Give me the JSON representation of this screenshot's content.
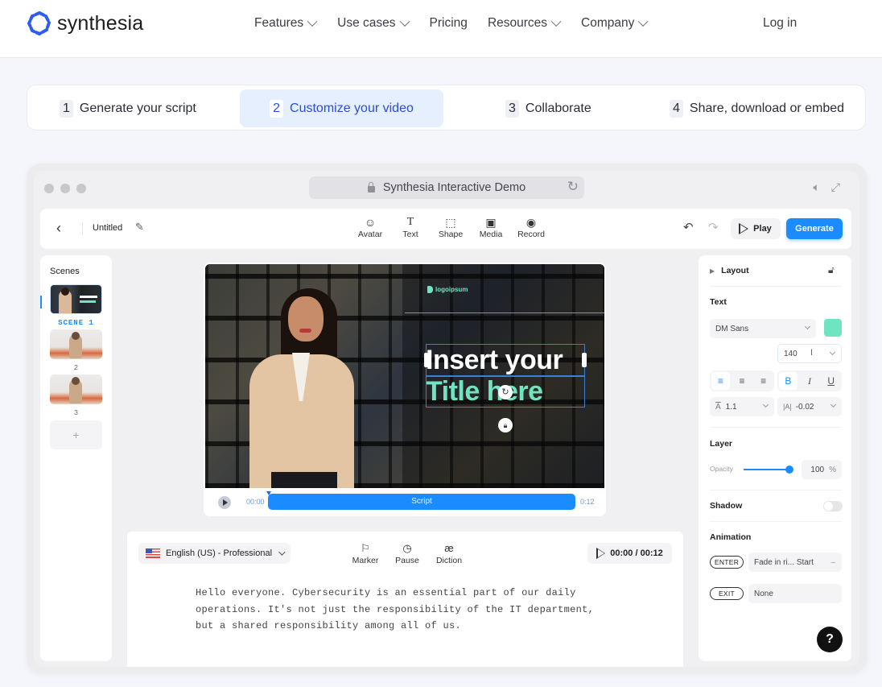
{
  "brand": {
    "name": "synthesia",
    "accent": "#2a4fd8"
  },
  "nav": {
    "items": [
      {
        "label": "Features",
        "dropdown": true
      },
      {
        "label": "Use cases",
        "dropdown": true
      },
      {
        "label": "Pricing",
        "dropdown": false
      },
      {
        "label": "Resources",
        "dropdown": true
      },
      {
        "label": "Company",
        "dropdown": true
      }
    ],
    "login": "Log in"
  },
  "steps": [
    {
      "num": "1",
      "label": "Generate your script",
      "active": false
    },
    {
      "num": "2",
      "label": "Customize your video",
      "active": true
    },
    {
      "num": "3",
      "label": "Collaborate",
      "active": false
    },
    {
      "num": "4",
      "label": "Share, download or embed",
      "active": false
    }
  ],
  "browser": {
    "url_title": "Synthesia Interactive Demo"
  },
  "editor": {
    "title": "Untitled",
    "tools": [
      {
        "icon": "avatar-icon",
        "label": "Avatar"
      },
      {
        "icon": "text-icon",
        "label": "Text"
      },
      {
        "icon": "shape-icon",
        "label": "Shape"
      },
      {
        "icon": "media-icon",
        "label": "Media"
      },
      {
        "icon": "record-icon",
        "label": "Record"
      }
    ],
    "play_label": "Play",
    "generate_label": "Generate",
    "generate_color": "#1a8cff"
  },
  "scenes": {
    "title": "Scenes",
    "items": [
      {
        "label": "SCENE 1",
        "active": true
      },
      {
        "label": "2",
        "active": false
      },
      {
        "label": "3",
        "active": false
      }
    ],
    "add_label": "+"
  },
  "canvas": {
    "logo_text": "logoipsum",
    "title_line1": "Insert your",
    "title_line2": "Title here",
    "title_line2_color": "#6ee5c0",
    "timeline": {
      "start": "00:00",
      "track_label": "Script",
      "end": "0:12"
    }
  },
  "script": {
    "language": "English (US) - Professional",
    "tools": [
      {
        "icon": "marker-icon",
        "label": "Marker"
      },
      {
        "icon": "pause-icon",
        "label": "Pause"
      },
      {
        "icon": "diction-icon",
        "label": "Diction"
      }
    ],
    "time": "00:00 / 00:12",
    "lines": [
      "Hello everyone. Cybersecurity is an essential part of our daily",
      "operations. It's not just the responsibility of the IT department,",
      "but a shared responsibility among all of us."
    ]
  },
  "properties": {
    "layout_label": "Layout",
    "text_label": "Text",
    "font": "DM Sans",
    "text_color": "#6ee5c0",
    "font_size": "140",
    "line_height": "1.1",
    "letter_spacing": "-0.02",
    "align_options": [
      "left",
      "center",
      "right"
    ],
    "align_selected": "left",
    "style_options": [
      "B",
      "I",
      "U"
    ],
    "style_selected": "B",
    "layer_label": "Layer",
    "opacity_label": "Opacity",
    "opacity_value": "100",
    "opacity_unit": "%",
    "opacity_fraction": 1.0,
    "shadow_label": "Shadow",
    "shadow_on": false,
    "animation_label": "Animation",
    "enter_label": "ENTER",
    "enter_value": "Fade in ri... Start",
    "exit_label": "EXIT",
    "exit_value": "None"
  },
  "help_label": "?"
}
